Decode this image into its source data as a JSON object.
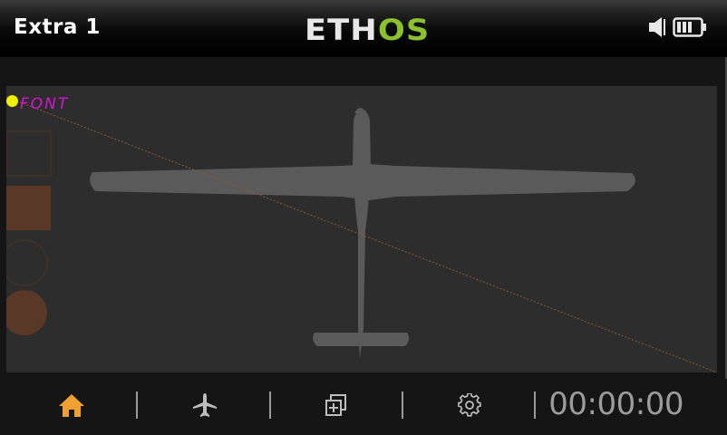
{
  "header": {
    "title": "Extra 1",
    "logo_eth": "ETH",
    "logo_os": "OS",
    "status_icons": [
      "speaker-icon",
      "battery-icon"
    ]
  },
  "canvas": {
    "label": "FONT",
    "label_color": "#d116d1",
    "dot_color": "#f0f000",
    "background": "#2d2d2d",
    "aircraft_color": "#5a5a5a",
    "swatch_color": "#5a3828"
  },
  "footer": {
    "nav_icons": [
      "home-icon",
      "airplane-icon",
      "layers-icon",
      "gear-icon"
    ],
    "active_icon": "home-icon",
    "active_color": "#f0a030",
    "timer": "00:00:00"
  }
}
